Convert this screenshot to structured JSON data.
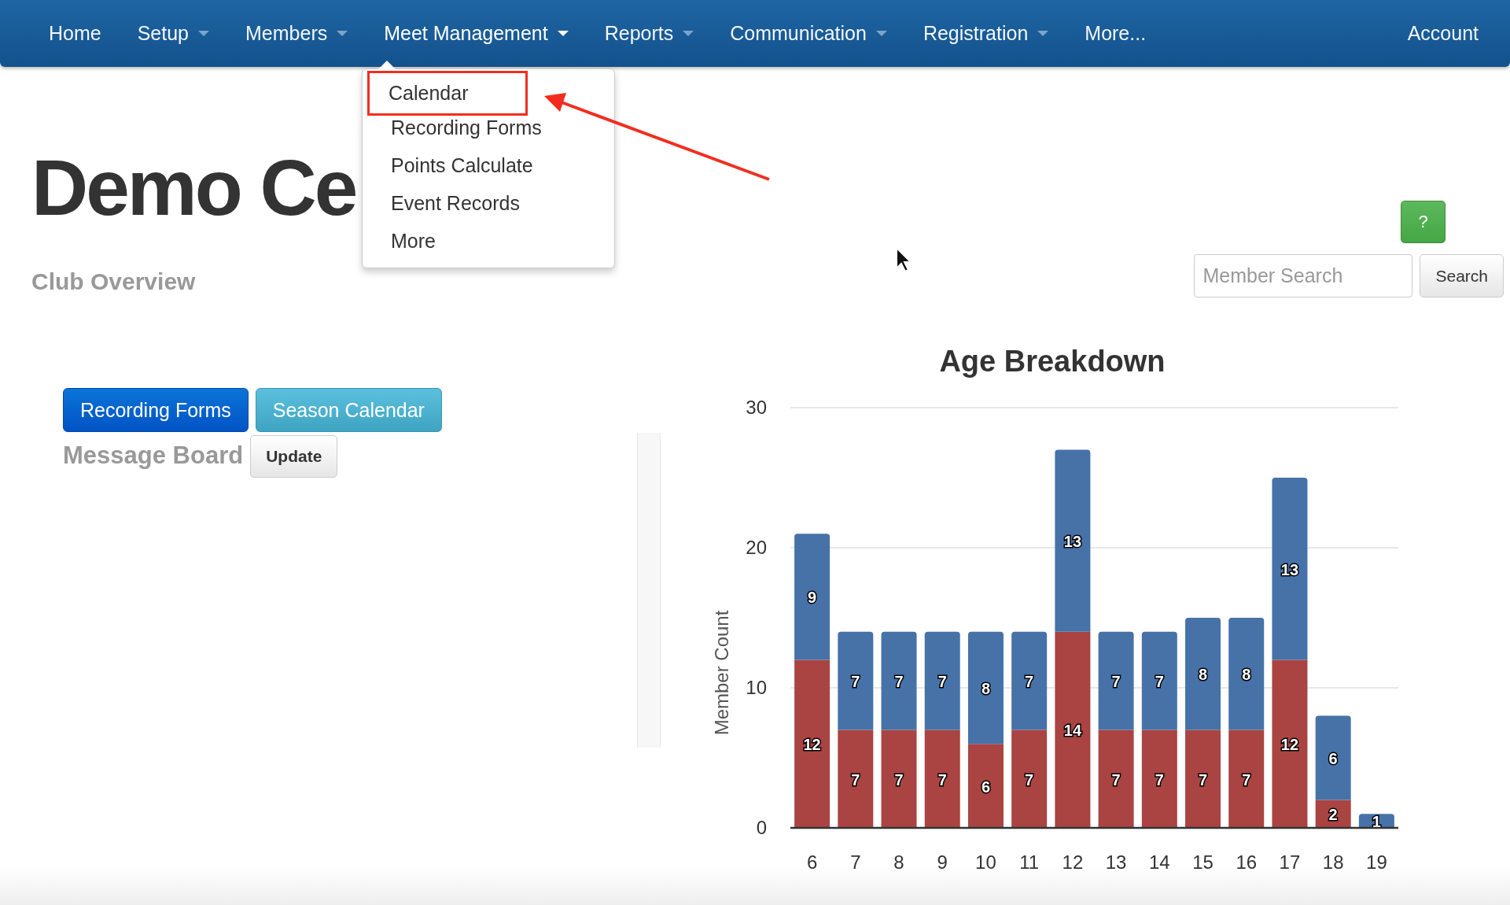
{
  "nav": {
    "items": [
      {
        "label": "Home",
        "dropdown": false,
        "open": false
      },
      {
        "label": "Setup",
        "dropdown": true,
        "open": false
      },
      {
        "label": "Members",
        "dropdown": true,
        "open": false
      },
      {
        "label": "Meet Management",
        "dropdown": true,
        "open": true
      },
      {
        "label": "Reports",
        "dropdown": true,
        "open": false
      },
      {
        "label": "Communication",
        "dropdown": true,
        "open": false
      },
      {
        "label": "Registration",
        "dropdown": true,
        "open": false
      },
      {
        "label": "More...",
        "dropdown": false,
        "open": false
      }
    ],
    "account": "Account"
  },
  "menu": {
    "items": [
      {
        "label": "Calendar",
        "highlighted": true
      },
      {
        "label": "Recording Forms",
        "highlighted": false
      },
      {
        "label": "Points Calculate",
        "highlighted": false
      },
      {
        "label": "Event Records",
        "highlighted": false
      },
      {
        "label": "More",
        "highlighted": false
      }
    ]
  },
  "title": "Demo Ce",
  "subtitle": "Club Overview",
  "help_button": "?",
  "search": {
    "placeholder": "Member Search",
    "button": "Search"
  },
  "action_buttons": [
    {
      "label": "Recording Forms",
      "kind": "primary"
    },
    {
      "label": "Season Calendar",
      "kind": "info"
    }
  ],
  "message_board": {
    "title": "Message Board",
    "button": "Update"
  },
  "chart": {
    "chart_data": {
      "type": "bar",
      "title": "Age Breakdown",
      "ylabel": "Member Count",
      "stacked": true,
      "data_labels": true,
      "categories": [
        "6",
        "7",
        "8",
        "9",
        "10",
        "11",
        "12",
        "13",
        "14",
        "15",
        "16",
        "17",
        "18",
        "19"
      ],
      "ylim": [
        0,
        30
      ],
      "yticks": [
        0,
        10,
        20,
        30
      ],
      "series": [
        {
          "color": "#a94442",
          "values": [
            12,
            7,
            7,
            7,
            6,
            7,
            14,
            7,
            7,
            7,
            7,
            12,
            2,
            null
          ]
        },
        {
          "color": "#4672a8",
          "values": [
            9,
            7,
            7,
            7,
            8,
            7,
            13,
            7,
            7,
            8,
            8,
            13,
            6,
            1
          ]
        }
      ]
    }
  }
}
